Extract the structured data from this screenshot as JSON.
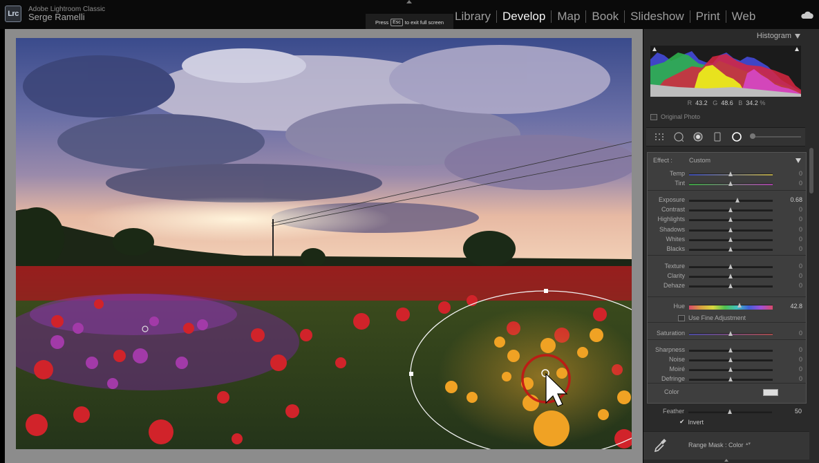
{
  "app": {
    "name": "Adobe Lightroom Classic",
    "user": "Serge Ramelli",
    "logo_text": "Lrc"
  },
  "modules": [
    "Library",
    "Develop",
    "Map",
    "Book",
    "Slideshow",
    "Print",
    "Web"
  ],
  "active_module": "Develop",
  "esc_hint": {
    "prefix": "Press",
    "key": "Esc",
    "suffix": "to exit full screen"
  },
  "histogram": {
    "title": "Histogram",
    "r_label": "R",
    "r_value": "43.2",
    "g_label": "G",
    "g_value": "48.6",
    "b_label": "B",
    "b_value": "34.2",
    "unit": "%",
    "original_photo": "Original Photo"
  },
  "tools": [
    "crop-overlay-icon",
    "spot-removal-icon",
    "red-eye-icon",
    "graduated-filter-icon",
    "radial-filter-icon",
    "adjustment-brush-icon"
  ],
  "effect": {
    "label": "Effect :",
    "value": "Custom"
  },
  "sliders": [
    {
      "id": "temp",
      "label": "Temp",
      "value": "0",
      "pos": 0.5,
      "group": 1
    },
    {
      "id": "tint",
      "label": "Tint",
      "value": "0",
      "pos": 0.5,
      "group": 1
    },
    {
      "id": "exposure",
      "label": "Exposure",
      "value": "0.68",
      "pos": 0.58,
      "group": 2
    },
    {
      "id": "contrast",
      "label": "Contrast",
      "value": "0",
      "pos": 0.5,
      "group": 2
    },
    {
      "id": "highlights",
      "label": "Highlights",
      "value": "0",
      "pos": 0.5,
      "group": 2
    },
    {
      "id": "shadows",
      "label": "Shadows",
      "value": "0",
      "pos": 0.5,
      "group": 2
    },
    {
      "id": "whites",
      "label": "Whites",
      "value": "0",
      "pos": 0.5,
      "group": 2
    },
    {
      "id": "blacks",
      "label": "Blacks",
      "value": "0",
      "pos": 0.5,
      "group": 2
    },
    {
      "id": "texture",
      "label": "Texture",
      "value": "0",
      "pos": 0.5,
      "group": 3
    },
    {
      "id": "clarity",
      "label": "Clarity",
      "value": "0",
      "pos": 0.5,
      "group": 3
    },
    {
      "id": "dehaze",
      "label": "Dehaze",
      "value": "0",
      "pos": 0.5,
      "group": 3
    },
    {
      "id": "hue",
      "label": "Hue",
      "value": "42.8",
      "pos": 0.61,
      "group": 4
    },
    {
      "id": "saturation",
      "label": "Saturation",
      "value": "0",
      "pos": 0.5,
      "group": 4
    },
    {
      "id": "sharpness",
      "label": "Sharpness",
      "value": "0",
      "pos": 0.5,
      "group": 5
    },
    {
      "id": "noise",
      "label": "Noise",
      "value": "0",
      "pos": 0.5,
      "group": 5
    },
    {
      "id": "moire",
      "label": "Moiré",
      "value": "0",
      "pos": 0.5,
      "group": 5
    },
    {
      "id": "defringe",
      "label": "Defringe",
      "value": "0",
      "pos": 0.5,
      "group": 5
    }
  ],
  "fine_adjustment": "Use Fine Adjustment",
  "color_label": "Color",
  "feather": {
    "label": "Feather",
    "value": "50",
    "pos": 0.5
  },
  "invert": {
    "label": "Invert",
    "checked": true
  },
  "range_mask": {
    "label": "Range Mask : Color"
  },
  "colors": {
    "accent": "#f2f2f2",
    "panel": "#3e3e3e",
    "background": "#2a2a2a"
  }
}
